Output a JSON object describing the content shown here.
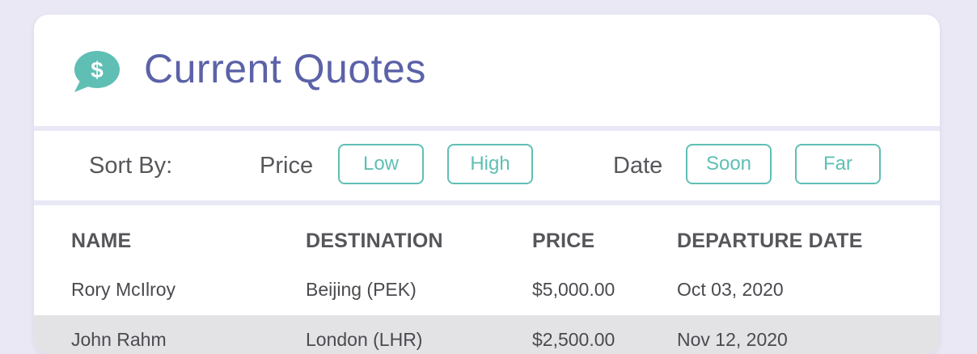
{
  "header": {
    "title": "Current Quotes",
    "icon": "dollar-chat-bubble-icon",
    "icon_symbol": "$",
    "icon_color": "#5fbfb4"
  },
  "sort": {
    "label": "Sort By:",
    "price_label": "Price",
    "price_low": "Low",
    "price_high": "High",
    "date_label": "Date",
    "date_soon": "Soon",
    "date_far": "Far"
  },
  "table": {
    "columns": [
      "NAME",
      "DESTINATION",
      "PRICE",
      "DEPARTURE DATE"
    ],
    "rows": [
      {
        "name": "Rory McIlroy",
        "destination": "Beijing (PEK)",
        "price": "$5,000.00",
        "date": "Oct 03, 2020"
      },
      {
        "name": "John Rahm",
        "destination": "London (LHR)",
        "price": "$2,500.00",
        "date": "Nov 12, 2020"
      }
    ]
  },
  "colors": {
    "background": "#e9e8f4",
    "title": "#5b62a8",
    "accent": "#5fbfb4",
    "text": "#55555a"
  }
}
